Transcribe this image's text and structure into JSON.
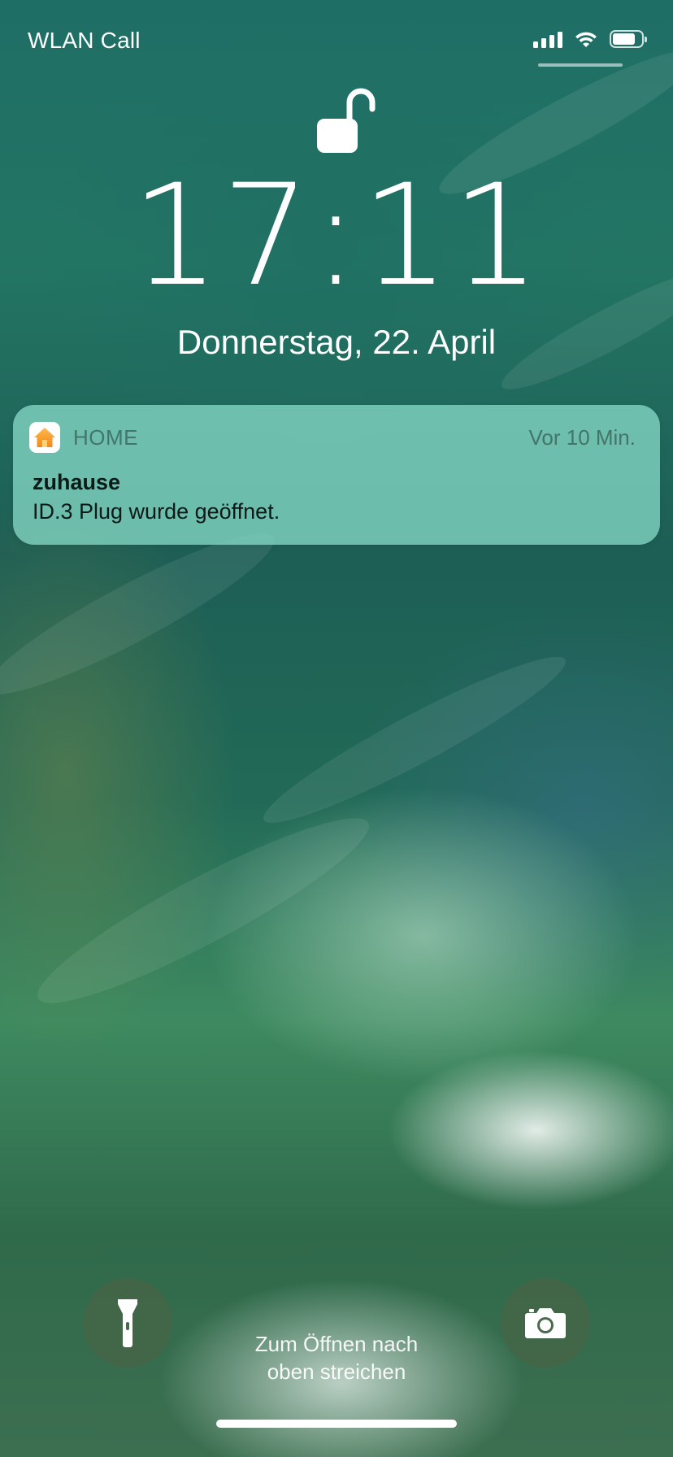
{
  "status_bar": {
    "carrier": "WLAN Call",
    "battery_level": 0.8
  },
  "lock_screen": {
    "time": "17:11",
    "date": "Donnerstag, 22. April",
    "lock_state": "unlocked"
  },
  "notification": {
    "app_name": "HOME",
    "timestamp": "Vor 10 Min.",
    "title": "zuhause",
    "body": "ID.3 Plug wurde geöffnet."
  },
  "bottom": {
    "unlock_hint_line1": "Zum Öffnen nach",
    "unlock_hint_line2": "oben streichen"
  },
  "icons": {
    "flashlight": "flashlight-icon",
    "camera": "camera-icon",
    "lock": "unlocked-padlock-icon",
    "app": "home-app-icon"
  }
}
